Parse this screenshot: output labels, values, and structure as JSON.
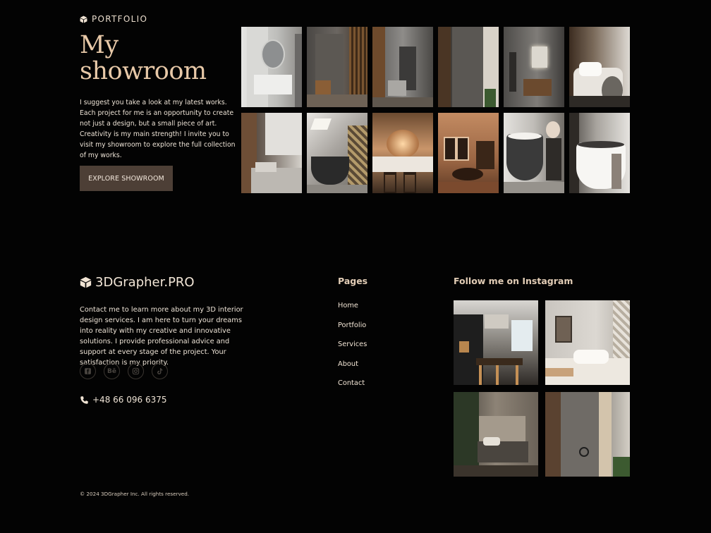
{
  "portfolio": {
    "eyebrow": "PORTFOLIO",
    "title_line1": "My",
    "title_line2": "showroom",
    "intro": "I suggest you take a look at my latest works. Each project for me is an opportunity to create not just a design, but a small piece of art. Creativity is my main strength! I invite you to visit my showroom to explore the full collection of my works.",
    "cta_label": "EXPLORE SHOWROOM",
    "icon": "cube-icon"
  },
  "footer": {
    "brand": "3DGrapher.PRO",
    "about": "Contact me to learn more about my 3D interior design services. I am here to turn your dreams into reality with my creative and innovative solutions. I provide professional advice and support at every stage of the project. Your satisfaction is my priority.",
    "socials": [
      "facebook-icon",
      "behance-icon",
      "instagram-icon",
      "tiktok-icon"
    ],
    "behance_text": "Bē",
    "phone": "+48 66 096 6375",
    "pages_heading": "Pages",
    "pages": [
      {
        "label": "Home"
      },
      {
        "label": "Portfolio"
      },
      {
        "label": "Services"
      },
      {
        "label": "About"
      },
      {
        "label": "Contact"
      }
    ],
    "instagram_heading": "Follow me on Instagram",
    "copyright": "© 2024 3DGrapher Inc. All rights reserved."
  },
  "colors": {
    "background": "#030303",
    "accent_title": "#e8c9a8",
    "button_bg": "#4d3f36"
  }
}
